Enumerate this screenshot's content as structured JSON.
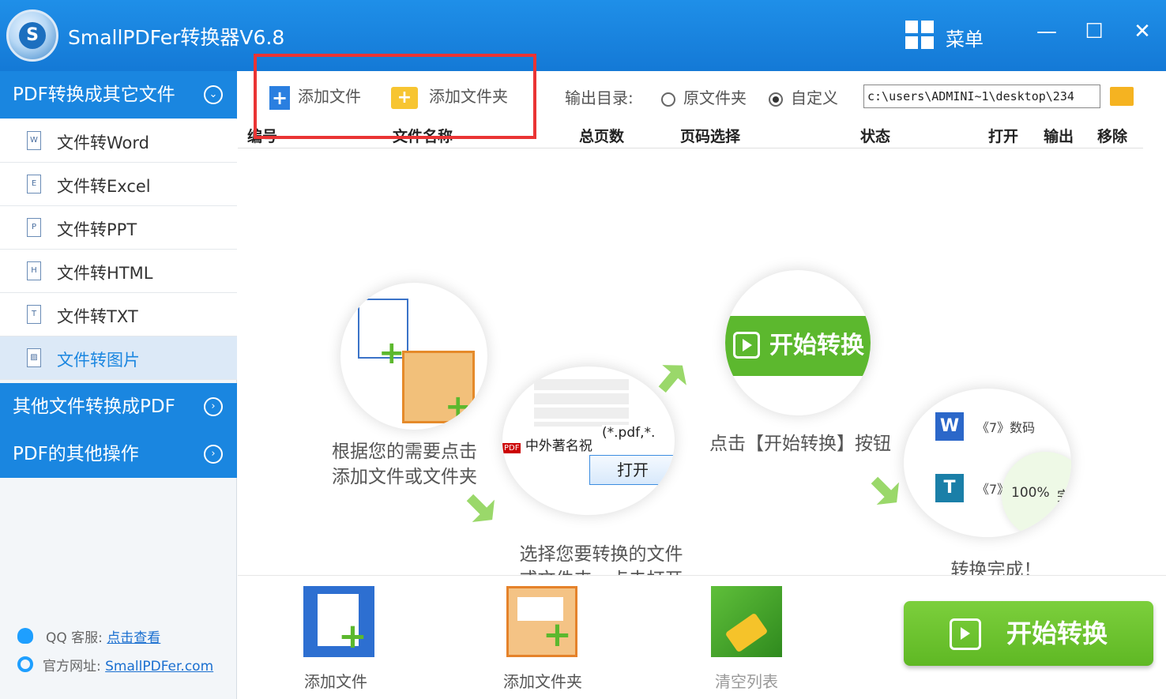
{
  "titlebar": {
    "title": "SmallPDFer转换器V6.8",
    "menu_label": "菜单",
    "minimize": "—",
    "maximize": "☐",
    "close": "✕"
  },
  "sidebar": {
    "section1": "PDF转换成其它文件",
    "items": [
      {
        "label": "文件转Word",
        "icon": "W"
      },
      {
        "label": "文件转Excel",
        "icon": "E"
      },
      {
        "label": "文件转PPT",
        "icon": "P"
      },
      {
        "label": "文件转HTML",
        "icon": "H"
      },
      {
        "label": "文件转TXT",
        "icon": "T"
      },
      {
        "label": "文件转图片",
        "icon": "▨"
      }
    ],
    "section2": "其他文件转换成PDF",
    "section3": "PDF的其他操作",
    "qq_label": "QQ 客服:",
    "qq_link": "点击查看",
    "site_label": "官方网址:",
    "site_link": "SmallPDFer.com"
  },
  "toolbar": {
    "add_file": "添加文件",
    "add_folder": "添加文件夹",
    "output_label": "输出目录:",
    "opt_source": "原文件夹",
    "opt_custom": "自定义",
    "output_path": "c:\\users\\ADMINI~1\\desktop\\234"
  },
  "table": {
    "headers": [
      "编号",
      "文件名称",
      "总页数",
      "页码选择",
      "状态",
      "打开",
      "输出",
      "移除"
    ]
  },
  "flow": {
    "step1_line1": "根据您的需要点击",
    "step1_line2": "添加文件或文件夹",
    "step2_line1": "选择您要转换的文件",
    "step2_line2": "或文件夹，点击打开",
    "step2_file": "中外著名祝",
    "step2_filter": "(*.pdf,*.",
    "step2_open": "打开",
    "step3_button": "开始转换",
    "step3_caption": "点击【开始转换】按钮",
    "step4_row1": "《7》数码",
    "step4_row2": "《7》",
    "step4_progress": "100%",
    "step4_done": "完成",
    "step4_caption": "转换完成！"
  },
  "bottom": {
    "add_file": "添加文件",
    "add_folder": "添加文件夹",
    "clear": "清空列表",
    "start": "开始转换"
  },
  "colors": {
    "titlebar": "#1a84e0",
    "sidebar_section": "#1a86e0",
    "highlight": "#ea3434",
    "green": "#5fb824"
  }
}
